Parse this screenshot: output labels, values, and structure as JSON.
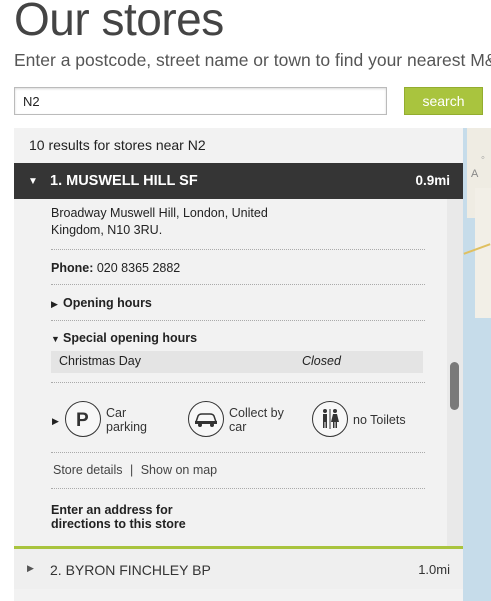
{
  "page": {
    "title": "Our stores",
    "subtitle": "Enter a postcode, street name or town to find your nearest M&"
  },
  "search": {
    "value": "N2",
    "button_label": "search"
  },
  "map": {
    "label": "A"
  },
  "results": {
    "count_text": "10 results for stores near N2",
    "stores": [
      {
        "name": "1. MUSWELL HILL SF",
        "distance": "0.9mi",
        "address_line1": "Broadway Muswell Hill, London, United",
        "address_line2": "Kingdom, N10 3RU.",
        "phone_label": "Phone:",
        "phone_value": "020 8365 2882",
        "opening_hours_label": "Opening hours",
        "special_hours_label": "Special opening hours",
        "special_day": "Christmas Day",
        "special_status": "Closed",
        "facilities": {
          "parking_line1": "Car",
          "parking_line2": "parking",
          "collect_line1": "Collect by",
          "collect_line2": "car",
          "toilets": "no Toilets"
        },
        "store_details_link": "Store details",
        "link_separator": "|",
        "show_on_map_link": "Show on map",
        "directions_line1": "Enter an address for",
        "directions_line2": "directions to this store"
      },
      {
        "name": "2. BYRON FINCHLEY BP",
        "distance": "1.0mi"
      }
    ]
  },
  "icons": {
    "expanded": "triangle-down-icon",
    "collapsed": "triangle-right-icon",
    "parking": "parking-icon",
    "collect": "car-icon",
    "toilets": "toilets-icon"
  },
  "colors": {
    "accent": "#a9c43e",
    "header_dark": "#353535",
    "panel_bg": "#f2f2f2"
  }
}
